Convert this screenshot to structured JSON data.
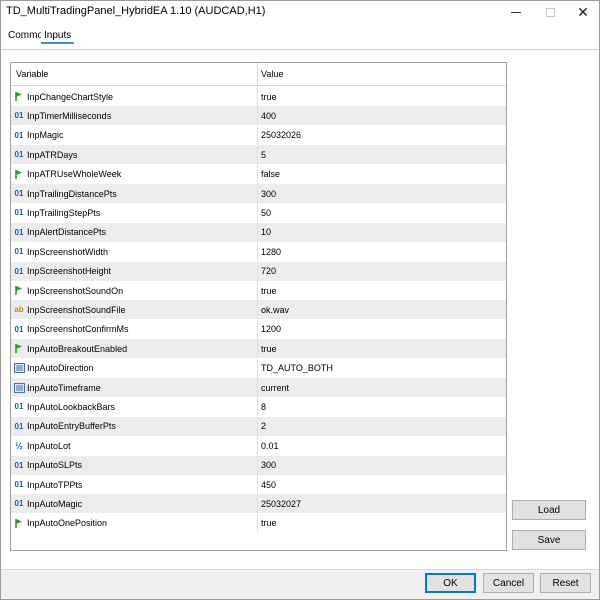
{
  "window": {
    "title": "TD_MultiTradingPanel_HybridEA 1.10 (AUDCAD,H1)",
    "controls": {
      "minimize": "—",
      "maximize": "□",
      "close": "✕"
    }
  },
  "tabs": [
    {
      "label": "Common",
      "active": false
    },
    {
      "label": "Inputs",
      "active": true
    }
  ],
  "grid": {
    "columns": {
      "variable": "Variable",
      "value": "Value"
    },
    "rows": [
      {
        "type": "bool",
        "icon": "bool-arrow-icon",
        "variable": "InpChangeChartStyle",
        "value": "true"
      },
      {
        "type": "int",
        "icon": "int-icon",
        "badge": "01",
        "variable": "InpTimerMilliseconds",
        "value": "400"
      },
      {
        "type": "int",
        "icon": "int-icon",
        "badge": "01",
        "variable": "InpMagic",
        "value": "25032026"
      },
      {
        "type": "int",
        "icon": "int-icon",
        "badge": "01",
        "variable": "InpATRDays",
        "value": "5"
      },
      {
        "type": "bool",
        "icon": "bool-arrow-icon",
        "variable": "InpATRUseWholeWeek",
        "value": "false"
      },
      {
        "type": "int",
        "icon": "int-icon",
        "badge": "01",
        "variable": "InpTrailingDistancePts",
        "value": "300"
      },
      {
        "type": "int",
        "icon": "int-icon",
        "badge": "01",
        "variable": "InpTrailingStepPts",
        "value": "50"
      },
      {
        "type": "int",
        "icon": "int-icon",
        "badge": "01",
        "variable": "InpAlertDistancePts",
        "value": "10"
      },
      {
        "type": "int",
        "icon": "int-icon",
        "badge": "01",
        "variable": "InpScreenshotWidth",
        "value": "1280"
      },
      {
        "type": "int",
        "icon": "int-icon",
        "badge": "01",
        "variable": "InpScreenshotHeight",
        "value": "720"
      },
      {
        "type": "bool",
        "icon": "bool-arrow-icon",
        "variable": "InpScreenshotSoundOn",
        "value": "true"
      },
      {
        "type": "string",
        "icon": "string-icon",
        "badge": "ab",
        "variable": "InpScreenshotSoundFile",
        "value": "ok.wav"
      },
      {
        "type": "int",
        "icon": "int-icon",
        "badge": "01",
        "variable": "InpScreenshotConfirmMs",
        "value": "1200"
      },
      {
        "type": "bool",
        "icon": "bool-arrow-icon",
        "variable": "InpAutoBreakoutEnabled",
        "value": "true"
      },
      {
        "type": "enum",
        "icon": "enum-list-icon",
        "variable": "InpAutoDirection",
        "value": "TD_AUTO_BOTH"
      },
      {
        "type": "enum",
        "icon": "enum-list-icon",
        "variable": "InpAutoTimeframe",
        "value": "current"
      },
      {
        "type": "int",
        "icon": "int-icon",
        "badge": "01",
        "variable": "InpAutoLookbackBars",
        "value": "8"
      },
      {
        "type": "int",
        "icon": "int-icon",
        "badge": "01",
        "variable": "InpAutoEntryBufferPts",
        "value": "2"
      },
      {
        "type": "double",
        "icon": "double-icon",
        "badge": "½",
        "variable": "InpAutoLot",
        "value": "0.01"
      },
      {
        "type": "int",
        "icon": "int-icon",
        "badge": "01",
        "variable": "InpAutoSLPts",
        "value": "300"
      },
      {
        "type": "int",
        "icon": "int-icon",
        "badge": "01",
        "variable": "InpAutoTPPts",
        "value": "450"
      },
      {
        "type": "int",
        "icon": "int-icon",
        "badge": "01",
        "variable": "InpAutoMagic",
        "value": "25032027"
      },
      {
        "type": "bool",
        "icon": "bool-arrow-icon",
        "variable": "InpAutoOnePosition",
        "value": "true"
      }
    ]
  },
  "buttons": {
    "load": "Load",
    "save": "Save",
    "ok": "OK",
    "cancel": "Cancel",
    "reset": "Reset"
  },
  "colors": {
    "accent": "#0078d7",
    "tab_underline": "#3b8fd6",
    "int_icon": "#1c5cb6",
    "string_icon": "#c88a00",
    "bool_icon": "#2e9a2e",
    "row_alt": "#ececec"
  }
}
